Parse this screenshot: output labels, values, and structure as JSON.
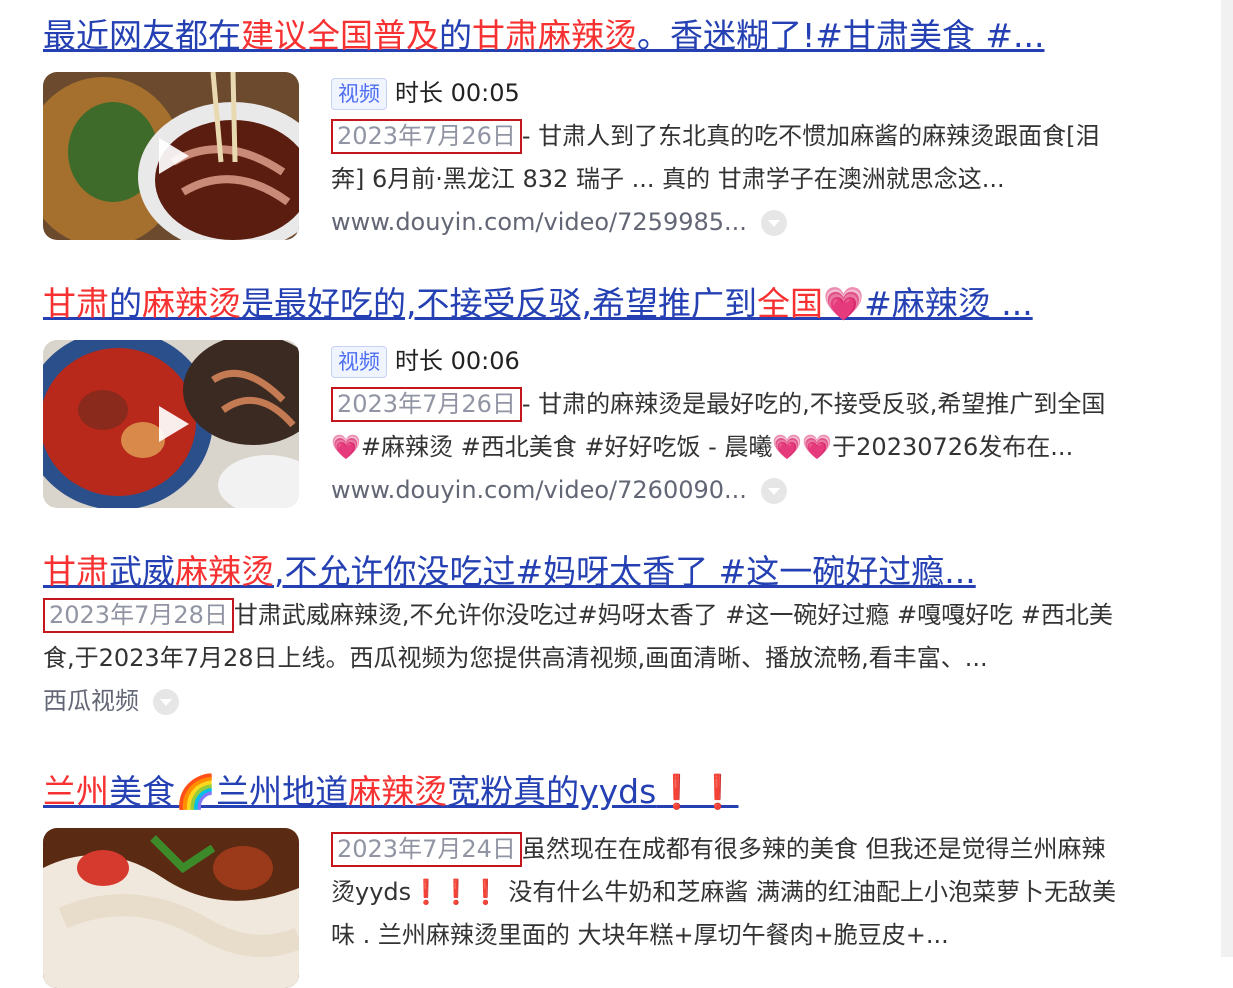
{
  "results": [
    {
      "title": [
        {
          "text": "最近网友都在",
          "hl": false
        },
        {
          "text": "建议全国普及",
          "hl": true
        },
        {
          "text": "的",
          "hl": false
        },
        {
          "text": "甘肃麻辣烫",
          "hl": true
        },
        {
          "text": "。香迷糊了!#甘肃美食 #...",
          "hl": false
        }
      ],
      "tag": "视频",
      "duration": "时长 00:05",
      "date": "2023年7月26日",
      "desc_line1": "- 甘肃人到了东北真的吃不惯加麻酱的麻辣烫跟面食[泪",
      "desc_line2": "奔] 6月前·黑龙江 832 瑞子 ... 真的 甘肃学子在澳洲就思念这...",
      "url": "www.douyin.com/video/7259985..."
    },
    {
      "title": [
        {
          "text": "甘肃",
          "hl": true
        },
        {
          "text": "的",
          "hl": false
        },
        {
          "text": "麻辣烫",
          "hl": true
        },
        {
          "text": "是最好吃的,不接受反驳,希望推广到",
          "hl": false
        },
        {
          "text": "全国",
          "hl": true
        },
        {
          "text": "💗#麻辣烫 ...",
          "hl": false
        }
      ],
      "tag": "视频",
      "duration": "时长 00:06",
      "date": "2023年7月26日",
      "desc_line1": "- 甘肃的麻辣烫是最好吃的,不接受反驳,希望推广到全国",
      "desc_line2": "💗#麻辣烫 #西北美食 #好好吃饭 - 晨曦💗💗于20230726发布在...",
      "url": "www.douyin.com/video/7260090..."
    },
    {
      "title": [
        {
          "text": "甘肃",
          "hl": true
        },
        {
          "text": "武威",
          "hl": false
        },
        {
          "text": "麻辣烫",
          "hl": true
        },
        {
          "text": ",不允许你没吃过#妈呀太香了 #这一碗好过瘾...",
          "hl": false
        }
      ],
      "date": "2023年7月28日",
      "desc_line1": "甘肃武威麻辣烫,不允许你没吃过#妈呀太香了 #这一碗好过瘾 #嘎嘎好吃 #西北美",
      "desc_line2": "食,于2023年7月28日上线。西瓜视频为您提供高清视频,画面清晰、播放流畅,看丰富、...",
      "source": "西瓜视频"
    },
    {
      "title": [
        {
          "text": "兰州",
          "hl": true
        },
        {
          "text": "美食🌈兰州地道",
          "hl": false
        },
        {
          "text": "麻辣烫",
          "hl": true
        },
        {
          "text": "宽粉真的yyds",
          "hl": false
        },
        {
          "text": "❗❗",
          "hl": true
        }
      ],
      "date": "2023年7月24日",
      "desc_line1": "虽然现在在成都有很多辣的美食 但我还是觉得兰州麻辣",
      "desc_line2": "烫yyds❗❗❗ 没有什么牛奶和芝麻酱 满满的红油配上小泡菜萝卜无敌美",
      "desc_line3": "味 . 兰州麻辣烫里面的 大块年糕+厚切午餐肉+脆豆皮+..."
    }
  ]
}
